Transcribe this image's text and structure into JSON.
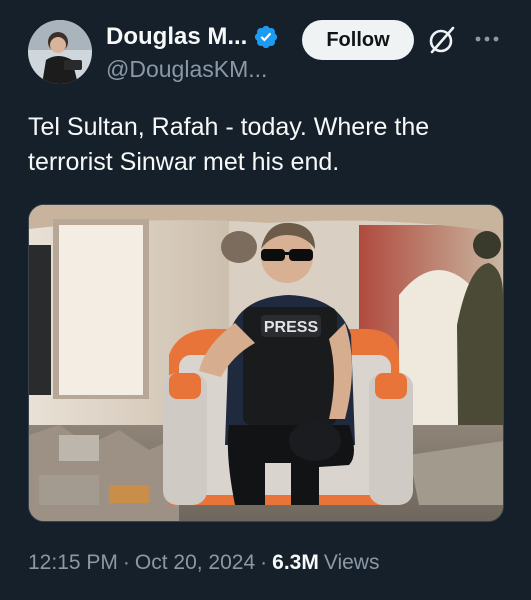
{
  "tweet": {
    "author": {
      "display_name": "Douglas M...",
      "handle": "@DouglasKM...",
      "verified_icon": "verified-badge-icon",
      "avatar_icon": "avatar"
    },
    "follow_label": "Follow",
    "text": "Tel Sultan, Rafah - today. Where the terrorist Sinwar met his end.",
    "media": {
      "vest_label": "PRESS"
    },
    "time": "12:15 PM",
    "separator": "·",
    "date": "Oct 20, 2024",
    "views_count": "6.3M",
    "views_label": "Views"
  },
  "colors": {
    "background": "#15202b",
    "text_primary": "#f7f9f9",
    "text_secondary": "#8b98a5",
    "verified_blue": "#1d9bf0",
    "follow_bg": "#eff3f4",
    "chair_orange": "#e8743a"
  },
  "icons": [
    "grok-icon",
    "more-options-icon",
    "verified-badge-icon"
  ]
}
